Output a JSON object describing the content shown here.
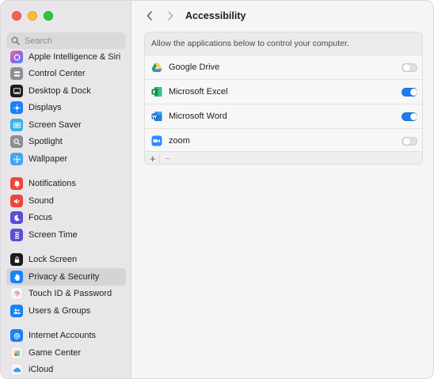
{
  "sidebar": {
    "search_placeholder": "Search",
    "items": [
      {
        "label": "Apple Intelligence & Siri",
        "icon": "siri-icon",
        "color": "#b45fd8"
      },
      {
        "label": "Control Center",
        "icon": "control-center-icon",
        "color": "#8e8e93"
      },
      {
        "label": "Desktop & Dock",
        "icon": "dock-icon",
        "color": "#1c1c1e"
      },
      {
        "label": "Displays",
        "icon": "displays-icon",
        "color": "#1a82f7"
      },
      {
        "label": "Screen Saver",
        "icon": "screen-saver-icon",
        "color": "#37b3e8"
      },
      {
        "label": "Spotlight",
        "icon": "spotlight-icon",
        "color": "#8e8e93"
      },
      {
        "label": "Wallpaper",
        "icon": "wallpaper-icon",
        "color": "#3fa9f5"
      },
      {
        "label": "Notifications",
        "icon": "notifications-icon",
        "color": "#f0463a"
      },
      {
        "label": "Sound",
        "icon": "sound-icon",
        "color": "#f0463a"
      },
      {
        "label": "Focus",
        "icon": "focus-icon",
        "color": "#5b4fd6"
      },
      {
        "label": "Screen Time",
        "icon": "screen-time-icon",
        "color": "#5b4fd6"
      },
      {
        "label": "Lock Screen",
        "icon": "lock-screen-icon",
        "color": "#1c1c1e"
      },
      {
        "label": "Privacy & Security",
        "icon": "privacy-hand-icon",
        "color": "#1a82f7"
      },
      {
        "label": "Touch ID & Password",
        "icon": "touch-id-icon",
        "color": "#f7f7f7"
      },
      {
        "label": "Users & Groups",
        "icon": "users-icon",
        "color": "#1a82f7"
      },
      {
        "label": "Internet Accounts",
        "icon": "internet-accounts-icon",
        "color": "#1a82f7"
      },
      {
        "label": "Game Center",
        "icon": "game-center-icon",
        "color": "#f4f4f4"
      },
      {
        "label": "iCloud",
        "icon": "icloud-icon",
        "color": "#f4f4f4"
      }
    ],
    "selected": "Privacy & Security"
  },
  "header": {
    "title": "Accessibility"
  },
  "panel": {
    "description": "Allow the applications below to control your computer.",
    "apps": [
      {
        "name": "Google Drive",
        "icon": "google-drive-icon",
        "enabled": false
      },
      {
        "name": "Microsoft Excel",
        "icon": "excel-icon",
        "enabled": true
      },
      {
        "name": "Microsoft Word",
        "icon": "word-icon",
        "enabled": true
      },
      {
        "name": "zoom",
        "icon": "zoom-icon",
        "enabled": false
      }
    ],
    "add_label": "+",
    "remove_label": "−"
  },
  "colors": {
    "accent": "#1f7cf2",
    "sidebar_bg": "#e9e6ea",
    "selected_bg": "#d6d3d7"
  }
}
